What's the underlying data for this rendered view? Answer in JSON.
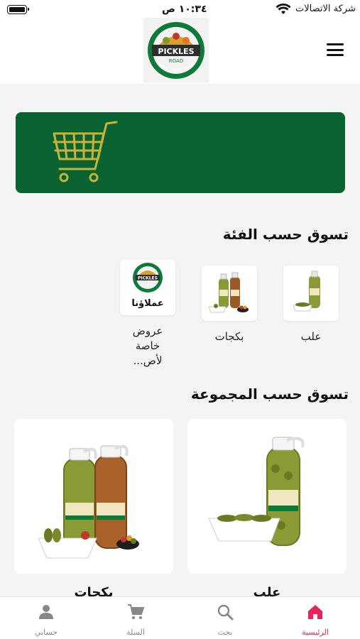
{
  "status_bar": {
    "time": "١٠:٣٤ ص",
    "carrier": "شركة الاتصالات"
  },
  "header": {
    "logo_text": "PICKLES",
    "logo_subtext": "ROAD"
  },
  "categories_section": {
    "title": "تسوق حسب الفئة",
    "items": [
      {
        "label": "علب"
      },
      {
        "label": "بكجات"
      },
      {
        "label": "عروض خاصة لأص...",
        "thumb_text": "عملاؤنا"
      }
    ]
  },
  "collections_section": {
    "title": "تسوق حسب المجموعة",
    "items": [
      {
        "label": "علب"
      },
      {
        "label": "بكجات"
      }
    ]
  },
  "bottom_nav": {
    "items": [
      {
        "label": "الرئيسية",
        "icon": "home-icon",
        "active": true
      },
      {
        "label": "بحث",
        "icon": "search-icon",
        "active": false
      },
      {
        "label": "السلة",
        "icon": "cart-icon",
        "active": false
      },
      {
        "label": "حسابي",
        "icon": "person-icon",
        "active": false
      }
    ]
  },
  "colors": {
    "brand_green": "#096330",
    "cart_gold": "#c8b23a",
    "active_pink": "#e8245a"
  }
}
